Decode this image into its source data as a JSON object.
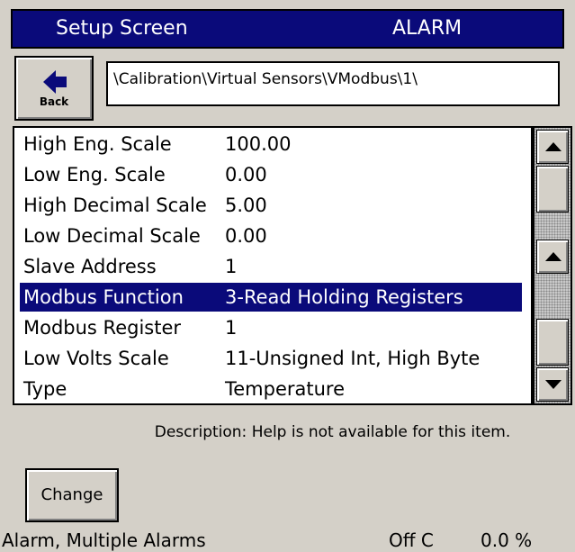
{
  "titlebar": {
    "left": "Setup Screen",
    "right": "ALARM"
  },
  "back_button": {
    "label": "Back"
  },
  "path": "\\Calibration\\Virtual Sensors\\VModbus\\1\\",
  "list": {
    "rows": [
      {
        "label": "High Eng. Scale",
        "value": "100.00"
      },
      {
        "label": "Low Eng. Scale",
        "value": "0.00"
      },
      {
        "label": "High Decimal Scale",
        "value": "5.00"
      },
      {
        "label": "Low Decimal Scale",
        "value": "0.00"
      },
      {
        "label": "Slave Address",
        "value": "1"
      },
      {
        "label": "Modbus Function",
        "value": "3-Read Holding Registers",
        "selected": true
      },
      {
        "label": "Modbus Register",
        "value": "1"
      },
      {
        "label": "Low Volts Scale",
        "value": "11-Unsigned Int, High Byte"
      },
      {
        "label": "Type",
        "value": "Temperature"
      }
    ]
  },
  "description": {
    "label": "Description:",
    "text": "Help is not available for this item."
  },
  "change_button": {
    "label": "Change"
  },
  "status": {
    "left": "Alarm, Multiple Alarms",
    "mid": "Off C",
    "right": "0.0 %"
  },
  "colors": {
    "title_bg": "#0a0a7a",
    "selection_bg": "#0a0a7a",
    "panel_bg": "#d4d0c8"
  }
}
